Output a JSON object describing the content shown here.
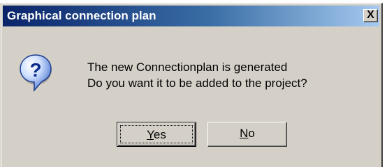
{
  "dialog": {
    "title": "Graphical connection plan",
    "close_label": "X",
    "icon": "question-icon",
    "message_line1": "The new Connectionplan is generated",
    "message_line2": "Do you want it to be added to the project?",
    "buttons": {
      "yes": {
        "mnemonic": "Y",
        "rest": "es"
      },
      "no": {
        "mnemonic": "N",
        "rest": "o"
      }
    }
  }
}
